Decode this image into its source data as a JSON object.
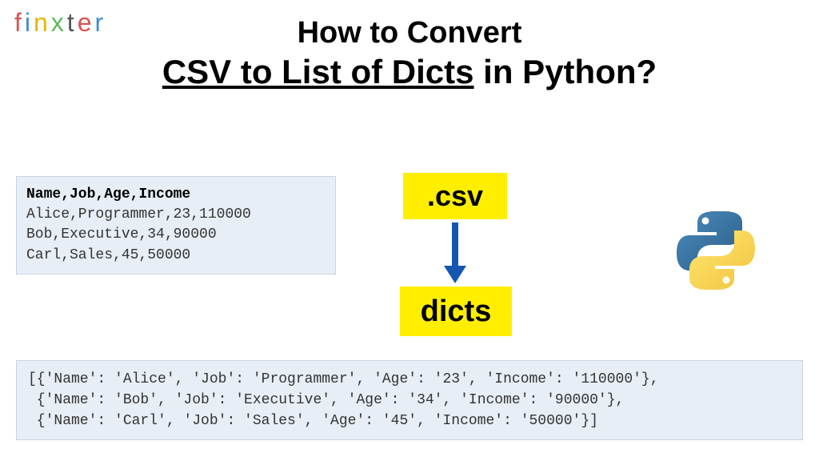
{
  "logo": {
    "f": "f",
    "i": "i",
    "n": "n",
    "x": "x",
    "t": "t",
    "e": "e",
    "r": "r"
  },
  "title": {
    "line1": "How to Convert",
    "line2_underlined": "CSV to List of Dicts",
    "line2_rest": " in Python?"
  },
  "csv": {
    "header": "Name,Job,Age,Income",
    "row1": "Alice,Programmer,23,110000",
    "row2": "Bob,Executive,34,90000",
    "row3": "Carl,Sales,45,50000"
  },
  "tags": {
    "csv": ".csv",
    "dicts": "dicts"
  },
  "output": {
    "line1": "[{'Name': 'Alice', 'Job': 'Programmer', 'Age': '23', 'Income': '110000'},",
    "line2": " {'Name': 'Bob', 'Job': 'Executive', 'Age': '34', 'Income': '90000'},",
    "line3": " {'Name': 'Carl', 'Job': 'Sales', 'Age': '45', 'Income': '50000'}]"
  }
}
